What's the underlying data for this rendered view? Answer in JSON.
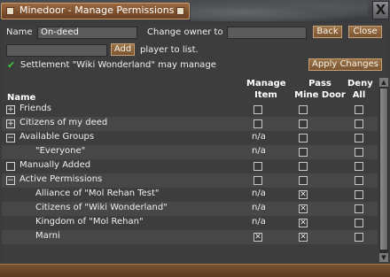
{
  "window": {
    "title": "Minedoor - Manage Permissions",
    "close_label": "X"
  },
  "form": {
    "name_label": "Name",
    "name_value": "On-deed",
    "change_owner_label": "Change owner to",
    "owner_value": "",
    "back_label": "Back",
    "close_label": "Close",
    "add_value": "",
    "add_label": "Add",
    "add_suffix": "player to list.",
    "status_text": "Settlement \"Wiki Wonderland\" may manage",
    "apply_label": "Apply Changes"
  },
  "table": {
    "headers": {
      "name": "Name",
      "manage": [
        "Manage",
        "Item"
      ],
      "pass": [
        "Pass",
        "Mine Door"
      ],
      "deny": [
        "Deny",
        "All"
      ]
    },
    "rows": [
      {
        "name": "Friends",
        "expander": "+",
        "indent": 0,
        "manage": "box",
        "pass": "box",
        "deny": "box"
      },
      {
        "name": "Citizens of my deed",
        "expander": "+",
        "indent": 0,
        "manage": "box",
        "pass": "box",
        "deny": "box"
      },
      {
        "name": "Available Groups",
        "expander": "−",
        "indent": 0,
        "manage": "n/a",
        "pass": "box",
        "deny": "box"
      },
      {
        "name": "\"Everyone\"",
        "expander": "",
        "indent": 1,
        "manage": "n/a",
        "pass": "box",
        "deny": "box"
      },
      {
        "name": "Manually Added",
        "expander": "□",
        "indent": 0,
        "manage": "box",
        "pass": "box",
        "deny": "box"
      },
      {
        "name": "Active Permissions",
        "expander": "−",
        "indent": 0,
        "manage": "box",
        "pass": "box",
        "deny": "box"
      },
      {
        "name": "Alliance of \"Mol Rehan Test\"",
        "expander": "",
        "indent": 2,
        "manage": "n/a",
        "pass": "checked",
        "deny": "box"
      },
      {
        "name": "Citizens of \"Wiki Wonderland\"",
        "expander": "",
        "indent": 2,
        "manage": "n/a",
        "pass": "checked",
        "deny": "box"
      },
      {
        "name": "Kingdom of \"Mol Rehan\"",
        "expander": "",
        "indent": 2,
        "manage": "n/a",
        "pass": "checked",
        "deny": "box"
      },
      {
        "name": "Marni",
        "expander": "",
        "indent": 2,
        "manage": "checked",
        "pass": "checked",
        "deny": "box"
      }
    ]
  },
  "colors": {
    "title_tab": "#7a4e2c",
    "panel": "#3d3d3d",
    "checkmark": "#3fc43f"
  }
}
